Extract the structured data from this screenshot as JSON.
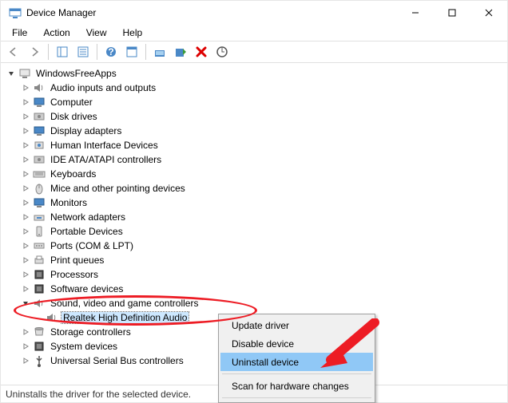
{
  "window": {
    "title": "Device Manager"
  },
  "menus": {
    "file": "File",
    "action": "Action",
    "view": "View",
    "help": "Help"
  },
  "tree": {
    "root": "WindowsFreeApps",
    "items": [
      "Audio inputs and outputs",
      "Computer",
      "Disk drives",
      "Display adapters",
      "Human Interface Devices",
      "IDE ATA/ATAPI controllers",
      "Keyboards",
      "Mice and other pointing devices",
      "Monitors",
      "Network adapters",
      "Portable Devices",
      "Ports (COM & LPT)",
      "Print queues",
      "Processors",
      "Software devices",
      "Sound, video and game controllers",
      "Storage controllers",
      "System devices",
      "Universal Serial Bus controllers"
    ],
    "sound_child": "Realtek High Definition Audio"
  },
  "context_menu": {
    "update": "Update driver",
    "disable": "Disable device",
    "uninstall": "Uninstall device",
    "scan": "Scan for hardware changes"
  },
  "statusbar": "Uninstalls the driver for the selected device."
}
